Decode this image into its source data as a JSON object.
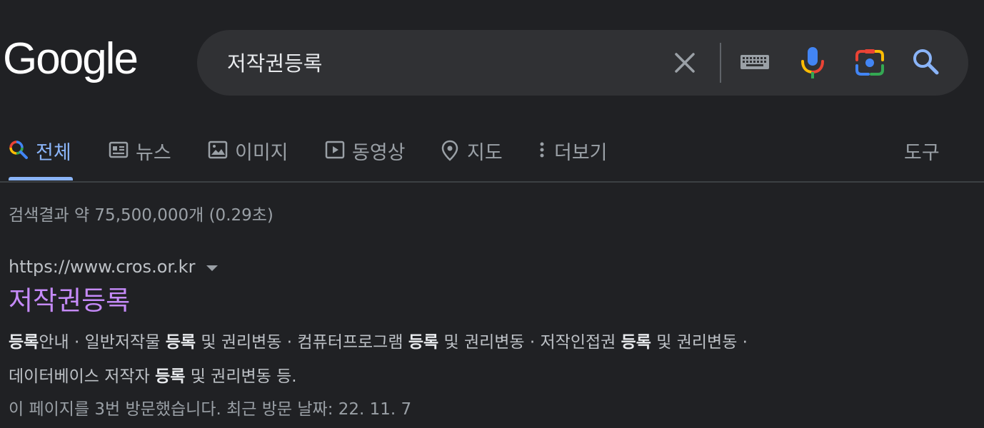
{
  "logo": {
    "text": "Google"
  },
  "search": {
    "query": "저작권등록"
  },
  "tabs": [
    {
      "label": "전체",
      "icon": "search-multicolor-icon",
      "active": true
    },
    {
      "label": "뉴스",
      "icon": "news-icon"
    },
    {
      "label": "이미지",
      "icon": "image-icon"
    },
    {
      "label": "동영상",
      "icon": "video-icon"
    },
    {
      "label": "지도",
      "icon": "map-pin-icon"
    },
    {
      "label": "더보기",
      "icon": "more-vert-icon"
    }
  ],
  "tools_label": "도구",
  "result_stats": "검색결과 약 75,500,000개 (0.29초)",
  "result": {
    "url": "https://www.cros.or.kr",
    "title": "저작권등록",
    "snippet_line1": [
      {
        "text": "등록",
        "bold": true
      },
      {
        "text": "안내 · 일반저작물 ",
        "bold": false
      },
      {
        "text": "등록",
        "bold": true
      },
      {
        "text": " 및 권리변동 · 컴퓨터프로그램 ",
        "bold": false
      },
      {
        "text": "등록",
        "bold": true
      },
      {
        "text": " 및 권리변동 · 저작인접권 ",
        "bold": false
      },
      {
        "text": "등록",
        "bold": true
      },
      {
        "text": " 및 권리변동 ·",
        "bold": false
      }
    ],
    "snippet_line2": [
      {
        "text": "데이터베이스 저작자 ",
        "bold": false
      },
      {
        "text": "등록",
        "bold": true
      },
      {
        "text": " 및 권리변동 등.",
        "bold": false
      }
    ],
    "visited": "이 페이지를 3번 방문했습니다. 최근 방문 날짜: 22. 11. 7"
  },
  "colors": {
    "background": "#202124",
    "search_box": "#303134",
    "active_tab": "#8ab4f8",
    "visited_link": "#c58af9"
  }
}
